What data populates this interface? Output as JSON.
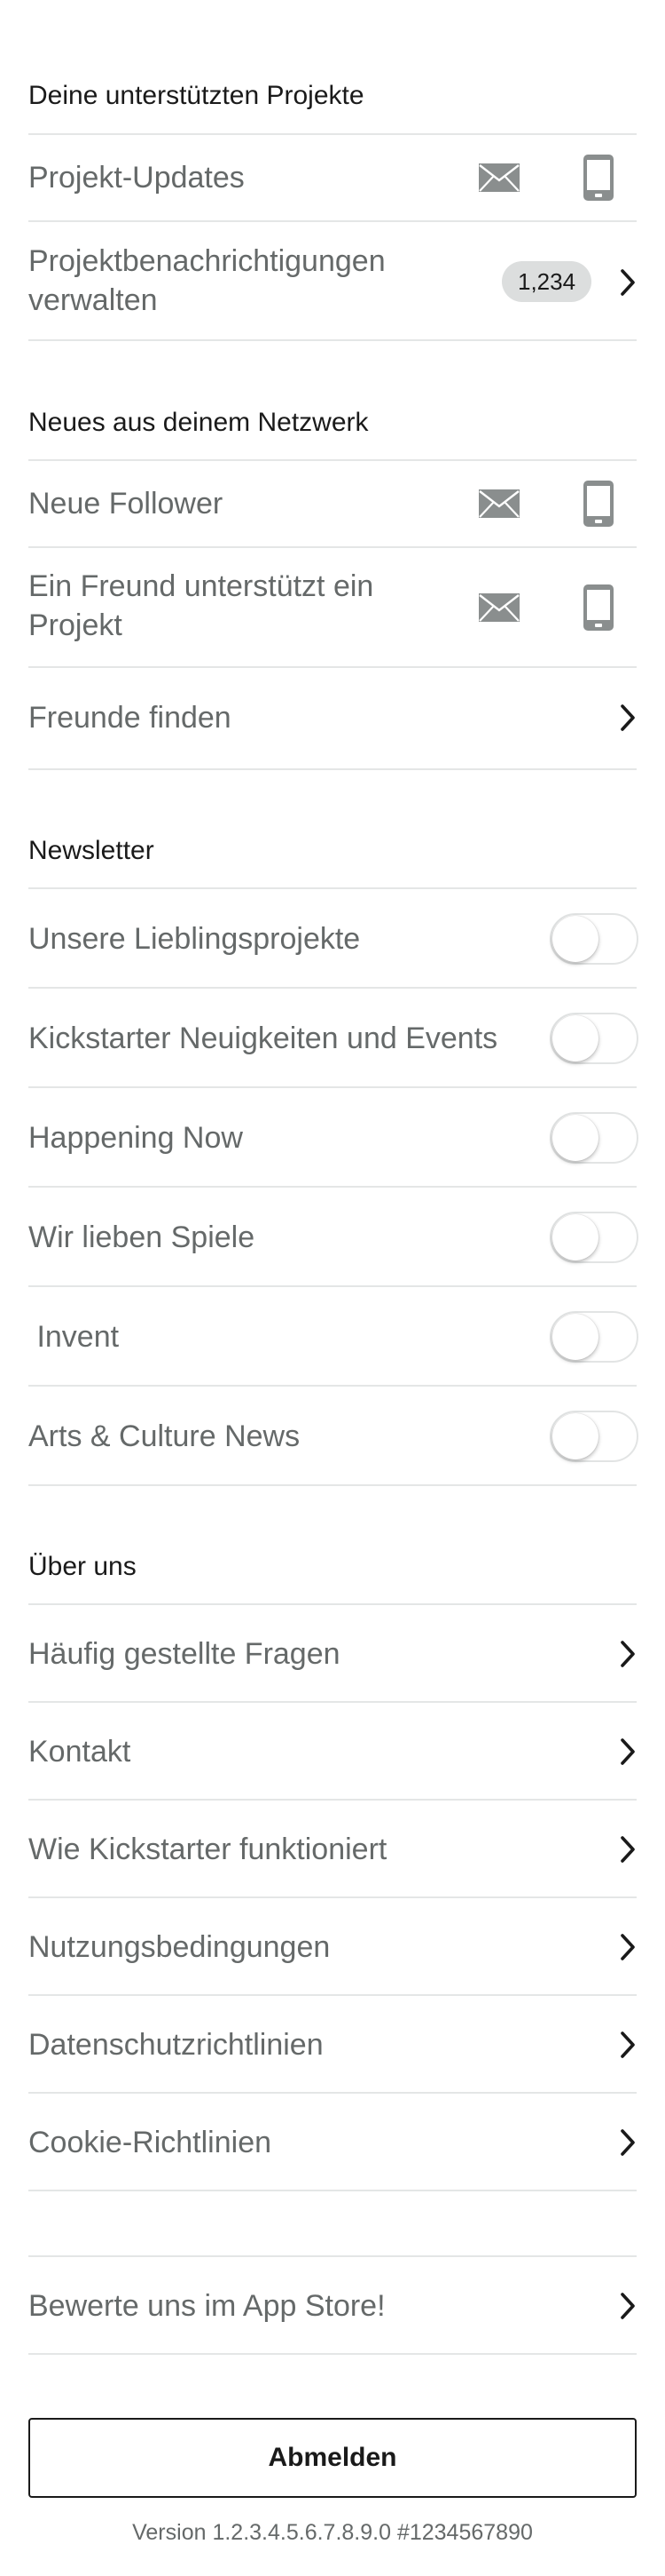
{
  "sections": {
    "supported": {
      "title": "Deine unterstützten Projekte",
      "project_updates": "Projekt-Updates",
      "manage_notifications": [
        "Projektbenachrichtigungen",
        "verwalten"
      ],
      "badge_count": "1,234"
    },
    "network": {
      "title": "Neues aus deinem Netzwerk",
      "new_followers": "Neue Follower",
      "friend_backs": [
        "Ein Freund unterstützt ein",
        "Projekt"
      ],
      "find_friends": "Freunde finden"
    },
    "newsletter": {
      "title": "Newsletter",
      "items": [
        {
          "label": "Unsere Lieblingsprojekte",
          "enabled": false
        },
        {
          "label": "Kickstarter Neuigkeiten und Events",
          "enabled": false
        },
        {
          "label": "Happening Now",
          "enabled": false
        },
        {
          "label": "Wir lieben Spiele",
          "enabled": false
        },
        {
          "label": " Invent",
          "enabled": false
        },
        {
          "label": "Arts & Culture News",
          "enabled": false
        }
      ]
    },
    "about": {
      "title": "Über uns",
      "items": [
        "Häufig gestellte Fragen",
        "Kontakt",
        "Wie Kickstarter funktioniert",
        "Nutzungsbedingungen",
        "Datenschutzrichtlinien",
        "Cookie-Richtlinien"
      ]
    },
    "rate": {
      "label": "Bewerte uns im App Store!"
    }
  },
  "logout_label": "Abmelden",
  "version_text": "Version 1.2.3.4.5.6.7.8.9.0 #1234567890",
  "icons": {
    "mail": "mail-icon",
    "phone": "phone-icon",
    "chevron": "chevron-right-icon"
  },
  "colors": {
    "text_primary": "#1a1a1a",
    "text_secondary": "#656969",
    "divider": "#e4e6e6",
    "icon_gray": "#8a8e8e",
    "badge_bg": "#dcdede"
  }
}
